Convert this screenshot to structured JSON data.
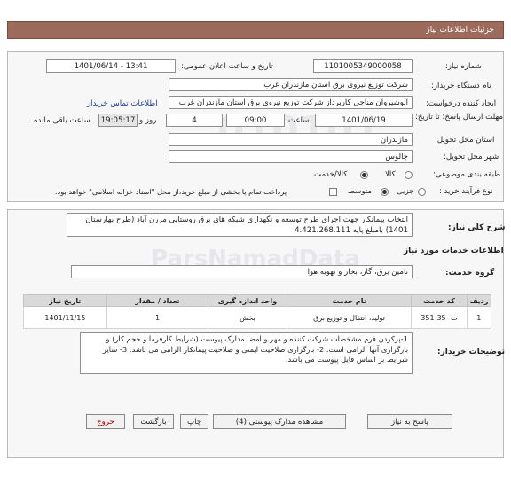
{
  "header": {
    "title": "جزئیات اطلاعات نیاز"
  },
  "fields": {
    "need_number_label": "شماره نیاز:",
    "need_number": "1101005349000058",
    "announce_label": "تاریخ و ساعت اعلان عمومی:",
    "announce_value": "1401/06/14 - 13:41",
    "buyer_label": "نام دستگاه خریدار:",
    "buyer_value": "شرکت توزیع نیروی برق استان مازندران غرب",
    "creator_label": "ایجاد کننده درخواست:",
    "creator_value": "انوشیروان مناجی کارپرداز شرکت توزیع نیروی برق استان مازندران غرب",
    "contact_link": "اطلاعات تماس خریدار",
    "deadline_label": "مهلت ارسال پاسخ: تا تاریخ:",
    "deadline_date": "1401/06/19",
    "time_label": "ساعت",
    "deadline_time": "09:00",
    "days_value": "4",
    "days_label": "روز و",
    "remaining_time": "19:05:17",
    "remaining_label": "ساعت باقی مانده",
    "province_label": "استان محل تحویل:",
    "province_value": "مازندران",
    "city_label": "شهر محل تحویل:",
    "city_value": "چالوس",
    "category_label": "طبقه بندی موضوعی:",
    "category_goods": "کالا",
    "category_service": "خدمت",
    "category_both": "کالا/خدمت",
    "process_label": "نوع فرآیند خرید :",
    "process_partial": "جزیی",
    "process_medium": "متوسط",
    "treasury_note": "پرداخت تمام یا بخشی از مبلغ خرید،از محل \"اسناد خزانه اسلامی\" خواهد بود."
  },
  "description": {
    "label": "شرح کلی نیاز:",
    "text": "انتخاب پیمانکار جهت اجرای طرح توسعه و نگهداری شبکه های برق روستایی مزرن آباد (طرح بهارستان 1401) بامبلغ پایه 4.421.268.111"
  },
  "services": {
    "title": "اطلاعات خدمات مورد نیاز",
    "group_label": "گروه خدمت:",
    "group_value": "تامین برق، گاز، بخار و تهویه هوا"
  },
  "table": {
    "headers": [
      "ردیف",
      "کد خدمت",
      "نام خدمت",
      "واحد اندازه گیری",
      "تعداد / مقدار",
      "تاریخ نیاز"
    ],
    "rows": [
      [
        "1",
        "ت -35-351",
        "تولید، انتقال و توزیع برق",
        "بخش",
        "1",
        "1401/11/15"
      ]
    ]
  },
  "notes": {
    "label": "توضیحات خریدار:",
    "text": "1-پرکردن فرم مشخصات شرکت کننده و مهر و امضا مدارک پیوست (شرایط کارفرما و حجم کار) و بارگزاری آنها الزامی است. 2- بارگزاری صلاحیت ایمنی و صلاحیت پیمانکار الزامی می باشد. 3- سایر شرایط بر اساس فایل پیوست می باشد."
  },
  "buttons": {
    "reply": "پاسخ به نیاز",
    "attachments": "مشاهده مدارک پیوستی (4)",
    "print": "چاپ",
    "back": "بازگشت",
    "exit": "خروج"
  },
  "watermark": {
    "text": "ParsNamadData",
    "numbers": "010101"
  }
}
